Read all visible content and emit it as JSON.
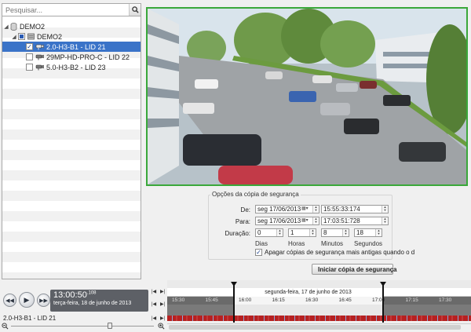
{
  "search": {
    "placeholder": "Pesquisar..."
  },
  "tree": {
    "root": {
      "label": "DEMO2"
    },
    "group": {
      "label": "DEMO2"
    },
    "cameras": [
      {
        "label": "2.0-H3-B1 - LID 21",
        "checked": true,
        "selected": true
      },
      {
        "label": "29MP-HD-PRO-C - LID 22",
        "checked": false,
        "selected": false
      },
      {
        "label": "5.0-H3-B2 - LID 23",
        "checked": false,
        "selected": false
      }
    ]
  },
  "backup": {
    "title": "Opções da cópia de segurança",
    "from": {
      "label": "De:",
      "date": "seg  17/06/2013",
      "time": "15:55:33:174"
    },
    "to": {
      "label": "Para:",
      "date": "seg  17/06/2013",
      "time": "17:03:51:728"
    },
    "duration": {
      "label": "Duração:",
      "days": {
        "value": "0",
        "unit": "Dias"
      },
      "hours": {
        "value": "1",
        "unit": "Horas"
      },
      "minutes": {
        "value": "8",
        "unit": "Minutos"
      },
      "seconds": {
        "value": "18",
        "unit": "Segundos"
      }
    },
    "delete_old": {
      "label": "Apagar cópias de segurança mais antigas quando o d",
      "checked": true
    },
    "start_button": "Iniciar cópia de segurança"
  },
  "player": {
    "time": "13:00:50",
    "ms": ".108",
    "date": "terça-feira, 18 de junho de 2013",
    "camera": "2.0-H3-B1 - LID 21"
  },
  "timeline": {
    "date_label": "segunda-feira, 17 de junho de 2013",
    "ticks": [
      "15:30",
      "15:45",
      "16:00",
      "16:15",
      "16:30",
      "16:45",
      "17:00",
      "17:15",
      "17:30"
    ]
  },
  "colors": {
    "selection": "#3a73c8",
    "video_border": "#3aa83a",
    "recording": "#b72020"
  }
}
